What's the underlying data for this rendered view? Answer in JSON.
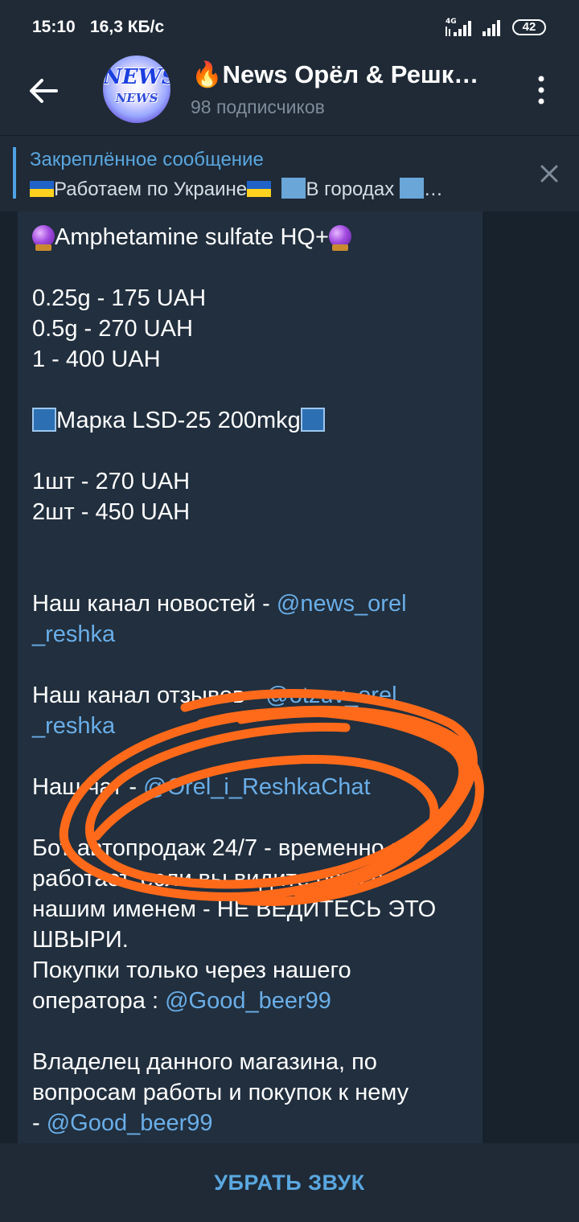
{
  "status_bar": {
    "time": "15:10",
    "speed": "16,3 КБ/с",
    "network": "4G",
    "battery": "42"
  },
  "header": {
    "title": "🔥News Орёл & Решк…",
    "subscribers": "98 подписчиков",
    "avatar_text_1": "NEWS",
    "avatar_text_2": "NEWS"
  },
  "pinned": {
    "label": "Закреплённое сообщение",
    "text_part1": "Работаем по Украине",
    "text_part2": "В городах",
    "ellipsis": "…"
  },
  "message": {
    "line_amph": "Amphetamine sulfate HQ+",
    "price_1": "0.25g - 175 UAH",
    "price_2": "0.5g - 270 UAH",
    "price_3": "1 - 400 UAH",
    "line_lsd": "Марка LSD-25 200mkg",
    "lsd_price_1": "1шт - 270 UAH",
    "lsd_price_2": "2шт - 450 UAH",
    "news_channel_label": "Наш канал новостей - ",
    "news_channel_link_1": "@news_orel",
    "news_channel_link_2": "_reshka",
    "reviews_label": "Наш канал отзывов - ",
    "reviews_link_1": "@otzuv_orel",
    "reviews_link_2": "_reshka",
    "chat_label": "Наш чат - ",
    "chat_link": "@Orel_i_ReshkaChat",
    "bot_line_1": "Бот автопродаж 24/7 - временно не",
    "bot_line_2": "работает, если вы видите бота с",
    "bot_line_3": "нашим именем - НЕ ВЕДИТЕСЬ ЭТО",
    "bot_line_4": "ШВЫРИ.",
    "purchase_line_1": "Покупки только через нашего",
    "purchase_line_2_label": "оператора : ",
    "purchase_link": "@Good_beer99",
    "owner_line_1": "Владелец данного магазина, по",
    "owner_line_2": "вопросам работы и покупок к нему",
    "owner_line_3_label": "- ",
    "owner_link": "@Good_beer99"
  },
  "bottom": {
    "mute_label": "УБРАТЬ ЗВУК"
  },
  "colors": {
    "accent": "#5aa7e0",
    "link": "#6aaee8",
    "scribble": "#ff6a1a"
  }
}
